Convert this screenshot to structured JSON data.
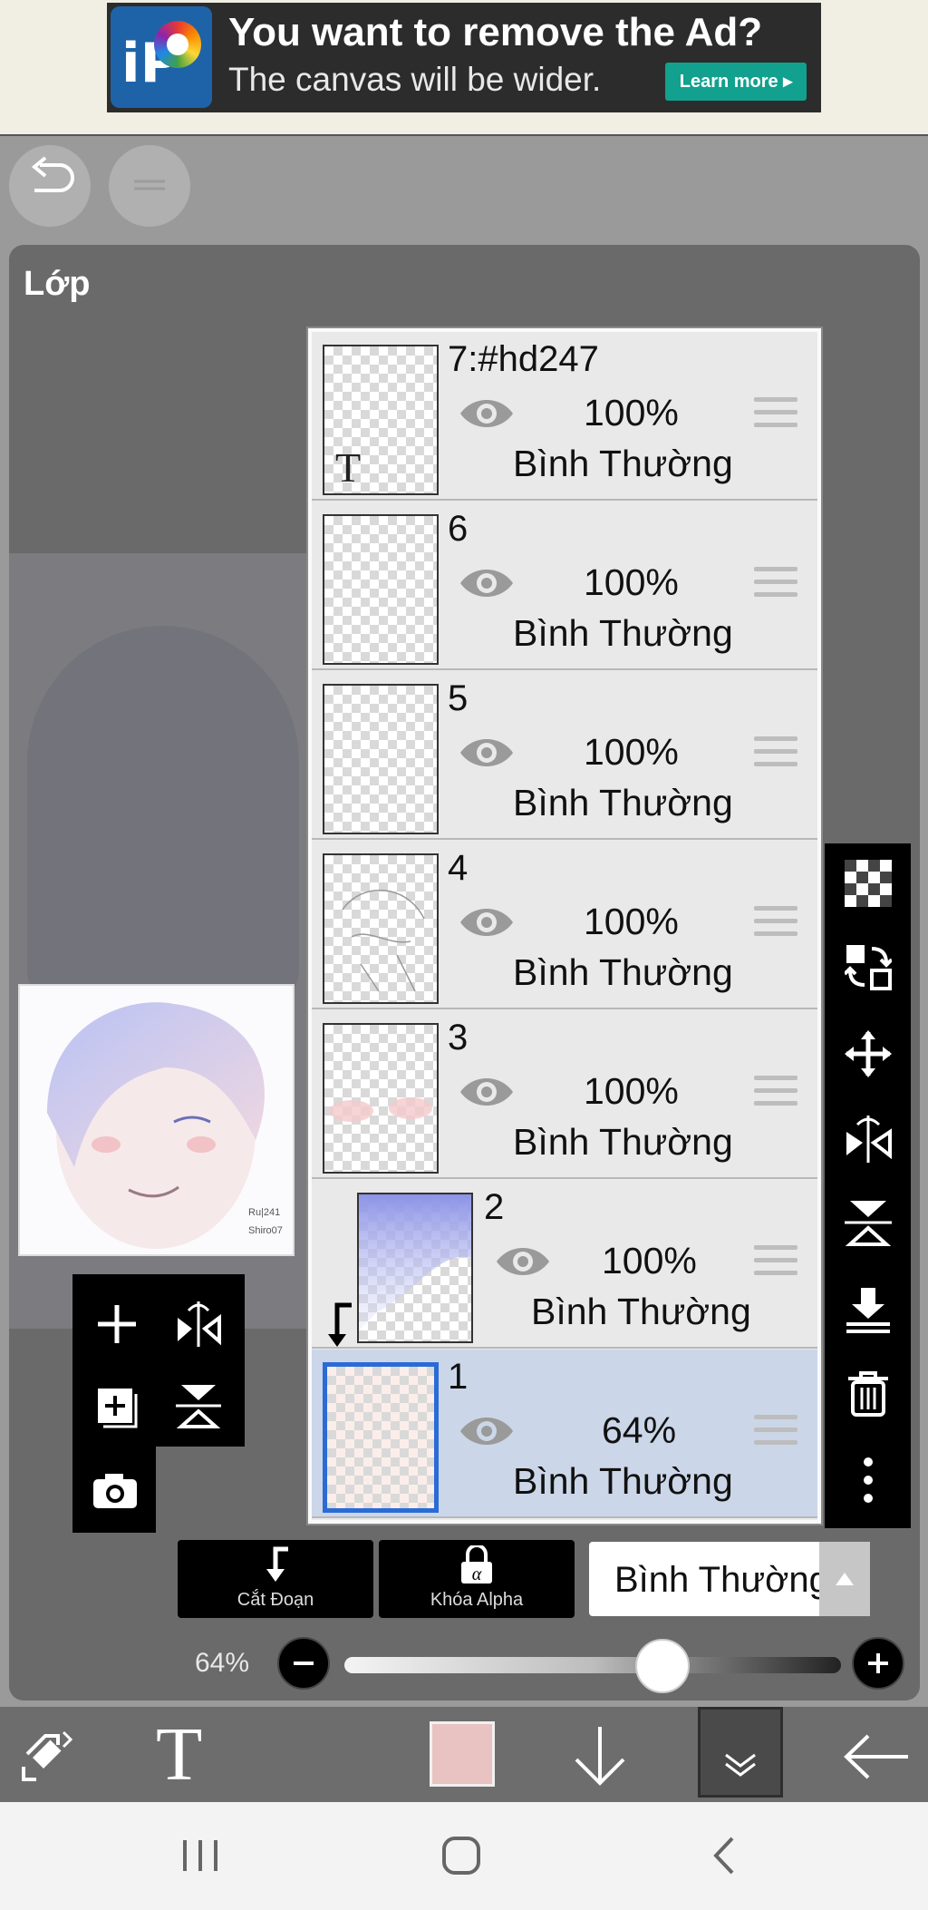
{
  "ad": {
    "title": "You want to remove the Ad?",
    "subtitle": "The canvas will be wider.",
    "learn_more": "Learn more ▸"
  },
  "panel": {
    "title": "Lớp"
  },
  "layers": [
    {
      "name": "7:#hd247",
      "opacity": "100%",
      "blend": "Bình Thường",
      "text_layer": "T"
    },
    {
      "name": "6",
      "opacity": "100%",
      "blend": "Bình Thường"
    },
    {
      "name": "5",
      "opacity": "100%",
      "blend": "Bình Thường"
    },
    {
      "name": "4",
      "opacity": "100%",
      "blend": "Bình Thường"
    },
    {
      "name": "3",
      "opacity": "100%",
      "blend": "Bình Thường"
    },
    {
      "name": "2",
      "opacity": "100%",
      "blend": "Bình Thường"
    },
    {
      "name": "1",
      "opacity": "64%",
      "blend": "Bình Thường"
    }
  ],
  "actions": {
    "clip_label": "Cắt Đoạn",
    "alpha_lock_label": "Khóa Alpha",
    "blend_mode": "Bình Thường"
  },
  "opacity": {
    "label": "64%",
    "value": 0.64
  },
  "preview": {
    "signature_text": "Ru|241 Shiro07"
  },
  "colors": {
    "selected_layer": "#cbd6e8",
    "brush_color": "#e8c3c1",
    "ad_button": "#12a18e",
    "selection_border": "#2a6bd6"
  },
  "icons": {
    "right_toolbar": [
      "checkerboard-icon",
      "transform-layers-icon",
      "move-icon",
      "flip-horizontal-icon",
      "flip-vertical-icon",
      "merge-down-icon",
      "trash-icon",
      "more-vertical-icon"
    ],
    "left_toolbar": [
      "plus-icon",
      "flip-horizontal-icon",
      "add-layer-icon",
      "flip-vertical-icon",
      "camera-icon"
    ],
    "bottom_bar": [
      "swap-icon",
      "text-tool-icon",
      "color-swatch",
      "arrow-down-icon",
      "chevron-double-down-icon",
      "back-arrow-icon"
    ]
  }
}
